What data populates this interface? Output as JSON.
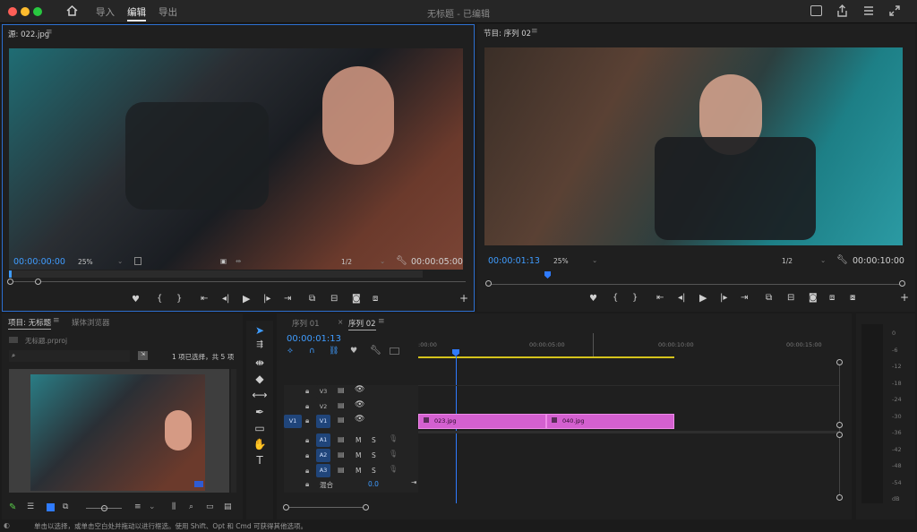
{
  "window": {
    "title": "无标题 - 已编辑",
    "nav_tabs": [
      "导入",
      "编辑",
      "导出"
    ],
    "active_tab": "编辑"
  },
  "source_monitor": {
    "title": "源: 022.jpg",
    "timecode": "00:00:00:00",
    "zoom": "25%",
    "resolution": "1/2",
    "duration": "00:00:05:00"
  },
  "program_monitor": {
    "title": "节目: 序列 02",
    "timecode": "00:00:01:13",
    "zoom": "25%",
    "resolution": "1/2",
    "duration": "00:00:10:00"
  },
  "project_panel": {
    "title": "项目: 无标题",
    "tab2": "媒体浏览器",
    "project_file": "无标题.prproj",
    "selection_info": "1 项已选择，共 5 项"
  },
  "timeline": {
    "tabs": [
      "序列 01",
      "序列 02"
    ],
    "active_tab": "序列 02",
    "timecode": "00:00:01:13",
    "ruler": [
      ":00:00",
      "00:00:05:00",
      "00:00:10:00",
      "00:00:15:00"
    ],
    "video_tracks": [
      "V3",
      "V2",
      "V1"
    ],
    "audio_tracks": [
      "A1",
      "A2",
      "A3"
    ],
    "source_patch": "V1",
    "mix_label": "混合",
    "mix_value": "0.0",
    "clips": [
      "023.jpg",
      "040.jpg"
    ],
    "track_mute": "M",
    "track_solo": "S"
  },
  "meter": {
    "scale": [
      "0",
      "-6",
      "-12",
      "-18",
      "-24",
      "-30",
      "-36",
      "-42",
      "-48",
      "-54",
      "dB"
    ]
  },
  "status_bar": {
    "text": "单击以选择，或单击空白处并拖动以进行框选。使用 Shift、Opt 和 Cmd 可获得其他选项。"
  },
  "colors": {
    "accent_blue": "#3f9cff",
    "clip_pink": "#d460d0",
    "playhead_blue": "#2f7bff",
    "work_area_yellow": "#d4c21c"
  }
}
